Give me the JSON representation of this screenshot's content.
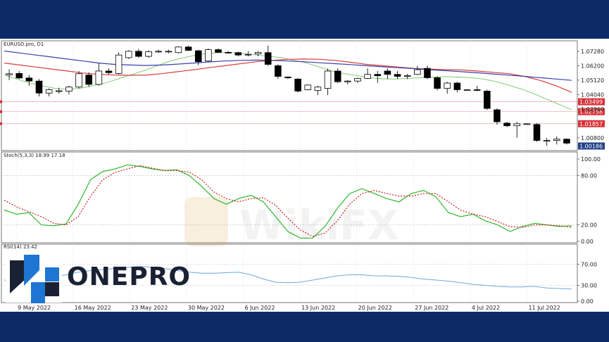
{
  "header": {
    "symbol_label": "EURUSD.pro, D1"
  },
  "stoch": {
    "label": "Stoch(5,3,3) 18.99 17.18"
  },
  "rsi": {
    "label": "RSI(14) 23.42"
  },
  "logo": {
    "text": "ONEPRO"
  },
  "watermark": {
    "text": "WikiFX"
  },
  "colors": {
    "frame": "#0b2a66",
    "ma_fast": "#79c46b",
    "ma_mid": "#d63d3d",
    "ma_slow": "#3b3ea8",
    "stoch_k": "#2eb82e",
    "stoch_d": "#cc2222",
    "rsi": "#6fa8dc",
    "price_box_red": "#d9333a",
    "price_box_blue": "#1f3f88",
    "logo_blue": "#1e76d2",
    "logo_dark": "#1a2133"
  },
  "chart_data": [
    {
      "type": "candlestick",
      "title": "EURUSD.pro, D1",
      "x_labels": [
        "9 May 2022",
        "16 May 2022",
        "23 May 2022",
        "30 May 2022",
        "6 Jun 2022",
        "13 Jun 2022",
        "20 Jun 2022",
        "27 Jun 2022",
        "4 Jul 2022",
        "11 Jul 2022"
      ],
      "y_ticks": [
        1.0728,
        1.062,
        1.0512,
        1.0404,
        1.0296,
        1.008
      ],
      "ylim": [
        1.0,
        1.078
      ],
      "price_markers": [
        {
          "value": 1.03499,
          "label": "1.03499",
          "style": "red"
        },
        {
          "value": 1.02758,
          "label": "1.02758",
          "style": "red"
        },
        {
          "value": 1.01857,
          "label": "1.01857",
          "style": "red"
        },
        {
          "value": 1.00186,
          "label": "1.00186",
          "style": "blue"
        }
      ],
      "candles": [
        {
          "o": 1.0552,
          "h": 1.0592,
          "l": 1.0512,
          "c": 1.056
        },
        {
          "o": 1.0562,
          "h": 1.058,
          "l": 1.052,
          "c": 1.0528
        },
        {
          "o": 1.0528,
          "h": 1.055,
          "l": 1.047,
          "c": 1.0505
        },
        {
          "o": 1.0505,
          "h": 1.052,
          "l": 1.039,
          "c": 1.0415
        },
        {
          "o": 1.0415,
          "h": 1.045,
          "l": 1.039,
          "c": 1.044
        },
        {
          "o": 1.043,
          "h": 1.0455,
          "l": 1.041,
          "c": 1.0432
        },
        {
          "o": 1.043,
          "h": 1.047,
          "l": 1.0405,
          "c": 1.046
        },
        {
          "o": 1.046,
          "h": 1.058,
          "l": 1.045,
          "c": 1.056
        },
        {
          "o": 1.055,
          "h": 1.057,
          "l": 1.046,
          "c": 1.048
        },
        {
          "o": 1.048,
          "h": 1.064,
          "l": 1.047,
          "c": 1.058
        },
        {
          "o": 1.058,
          "h": 1.06,
          "l": 1.0555,
          "c": 1.0568
        },
        {
          "o": 1.0562,
          "h": 1.072,
          "l": 1.0555,
          "c": 1.07
        },
        {
          "o": 1.068,
          "h": 1.0735,
          "l": 1.067,
          "c": 1.0728
        },
        {
          "o": 1.0728,
          "h": 1.0745,
          "l": 1.068,
          "c": 1.069
        },
        {
          "o": 1.069,
          "h": 1.0735,
          "l": 1.068,
          "c": 1.0725
        },
        {
          "o": 1.0725,
          "h": 1.074,
          "l": 1.0718,
          "c": 1.0728
        },
        {
          "o": 1.0728,
          "h": 1.074,
          "l": 1.0712,
          "c": 1.0728
        },
        {
          "o": 1.0718,
          "h": 1.0765,
          "l": 1.0712,
          "c": 1.076
        },
        {
          "o": 1.076,
          "h": 1.077,
          "l": 1.073,
          "c": 1.0735
        },
        {
          "o": 1.0732,
          "h": 1.074,
          "l": 1.0625,
          "c": 1.065
        },
        {
          "o": 1.0655,
          "h": 1.075,
          "l": 1.0648,
          "c": 1.074
        },
        {
          "o": 1.074,
          "h": 1.075,
          "l": 1.0715,
          "c": 1.072
        },
        {
          "o": 1.072,
          "h": 1.073,
          "l": 1.0712,
          "c": 1.0718
        },
        {
          "o": 1.0718,
          "h": 1.0725,
          "l": 1.069,
          "c": 1.07
        },
        {
          "o": 1.07,
          "h": 1.073,
          "l": 1.069,
          "c": 1.0705
        },
        {
          "o": 1.0708,
          "h": 1.073,
          "l": 1.069,
          "c": 1.072
        },
        {
          "o": 1.0718,
          "h": 1.077,
          "l": 1.062,
          "c": 1.063
        },
        {
          "o": 1.062,
          "h": 1.063,
          "l": 1.052,
          "c": 1.054
        },
        {
          "o": 1.0535,
          "h": 1.054,
          "l": 1.052,
          "c": 1.053
        },
        {
          "o": 1.052,
          "h": 1.0525,
          "l": 1.042,
          "c": 1.043
        },
        {
          "o": 1.044,
          "h": 1.048,
          "l": 1.0435,
          "c": 1.0475
        },
        {
          "o": 1.0435,
          "h": 1.047,
          "l": 1.04,
          "c": 1.046
        },
        {
          "o": 1.045,
          "h": 1.06,
          "l": 1.04,
          "c": 1.058
        },
        {
          "o": 1.058,
          "h": 1.06,
          "l": 1.049,
          "c": 1.05
        },
        {
          "o": 1.05,
          "h": 1.0512,
          "l": 1.048,
          "c": 1.0505
        },
        {
          "o": 1.0505,
          "h": 1.053,
          "l": 1.049,
          "c": 1.0525
        },
        {
          "o": 1.0525,
          "h": 1.06,
          "l": 1.052,
          "c": 1.0555
        },
        {
          "o": 1.0555,
          "h": 1.058,
          "l": 1.049,
          "c": 1.0545
        },
        {
          "o": 1.058,
          "h": 1.06,
          "l": 1.052,
          "c": 1.0555
        },
        {
          "o": 1.0555,
          "h": 1.058,
          "l": 1.052,
          "c": 1.054
        },
        {
          "o": 1.054,
          "h": 1.056,
          "l": 1.052,
          "c": 1.0545
        },
        {
          "o": 1.0555,
          "h": 1.062,
          "l": 1.055,
          "c": 1.059
        },
        {
          "o": 1.06,
          "h": 1.062,
          "l": 1.052,
          "c": 1.053
        },
        {
          "o": 1.053,
          "h": 1.054,
          "l": 1.0435,
          "c": 1.045
        },
        {
          "o": 1.045,
          "h": 1.05,
          "l": 1.041,
          "c": 1.049
        },
        {
          "o": 1.049,
          "h": 1.05,
          "l": 1.042,
          "c": 1.044
        },
        {
          "o": 1.044,
          "h": 1.0445,
          "l": 1.0435,
          "c": 1.044
        },
        {
          "o": 1.044,
          "h": 1.047,
          "l": 1.043,
          "c": 1.0435
        },
        {
          "o": 1.043,
          "h": 1.044,
          "l": 1.029,
          "c": 1.03
        },
        {
          "o": 1.029,
          "h": 1.03,
          "l": 1.018,
          "c": 1.02
        },
        {
          "o": 1.019,
          "h": 1.02,
          "l": 1.016,
          "c": 1.017
        },
        {
          "o": 1.017,
          "h": 1.02,
          "l": 1.008,
          "c": 1.0185
        },
        {
          "o": 1.0185,
          "h": 1.019,
          "l": 1.018,
          "c": 1.0185
        },
        {
          "o": 1.018,
          "h": 1.019,
          "l": 1.005,
          "c": 1.006
        },
        {
          "o": 1.0055,
          "h": 1.008,
          "l": 1.002,
          "c": 1.006
        },
        {
          "o": 1.006,
          "h": 1.009,
          "l": 1.003,
          "c": 1.007
        },
        {
          "o": 1.007,
          "h": 1.0075,
          "l": 1.003,
          "c": 1.004
        }
      ],
      "series": [
        {
          "key": "ma_fast",
          "color": "#79c46b",
          "values": [
            1.055,
            1.052,
            1.049,
            1.047,
            1.045,
            1.0445,
            1.045,
            1.047,
            1.049,
            1.052,
            1.055,
            1.058,
            1.0615,
            1.065,
            1.0675,
            1.0695,
            1.071,
            1.0718,
            1.0718,
            1.0712,
            1.07,
            1.069,
            1.068,
            1.066,
            1.064,
            1.061,
            1.058,
            1.056,
            1.0545,
            1.053,
            1.0522,
            1.052,
            1.0525,
            1.053,
            1.0535,
            1.0538,
            1.0535,
            1.053,
            1.052,
            1.05,
            1.0475,
            1.0445,
            1.041,
            1.037,
            1.033,
            1.029
          ]
        },
        {
          "key": "ma_mid",
          "color": "#d63d3d",
          "values": [
            1.064,
            1.0625,
            1.061,
            1.0595,
            1.058,
            1.0565,
            1.0555,
            1.055,
            1.0548,
            1.055,
            1.056,
            1.0575,
            1.059,
            1.0605,
            1.062,
            1.0635,
            1.065,
            1.066,
            1.0668,
            1.067,
            1.0668,
            1.066,
            1.0645,
            1.063,
            1.062,
            1.061,
            1.06,
            1.0595,
            1.059,
            1.0588,
            1.058,
            1.057,
            1.056,
            1.054,
            1.051,
            1.047,
            1.042
          ]
        },
        {
          "key": "ma_slow",
          "color": "#3b3ea8",
          "values": [
            1.073,
            1.0715,
            1.07,
            1.0685,
            1.067,
            1.0655,
            1.064,
            1.063,
            1.0625,
            1.0622,
            1.0625,
            1.0632,
            1.064,
            1.0648,
            1.0655,
            1.066,
            1.0662,
            1.066,
            1.0655,
            1.065,
            1.0642,
            1.0635,
            1.0628,
            1.062,
            1.0612,
            1.0605,
            1.0598,
            1.059,
            1.0583,
            1.0575,
            1.0567,
            1.0558,
            1.0549,
            1.054,
            1.053,
            1.052,
            1.051
          ]
        }
      ]
    },
    {
      "type": "line",
      "title": "Stoch(5,3,3) 18.99 17.18",
      "y_ticks": [
        100.0,
        80.0,
        20.0,
        0.0
      ],
      "ylim": [
        0,
        100
      ],
      "series": [
        {
          "key": "k",
          "color": "#2eb82e",
          "values": [
            38,
            33,
            35,
            20,
            19,
            21,
            45,
            75,
            85,
            88,
            93,
            91,
            88,
            86,
            87,
            80,
            67,
            52,
            45,
            52,
            56,
            48,
            30,
            12,
            4,
            4,
            18,
            40,
            58,
            64,
            58,
            52,
            48,
            58,
            62,
            54,
            35,
            30,
            33,
            25,
            20,
            12,
            18,
            22,
            20,
            18,
            19
          ]
        },
        {
          "key": "d",
          "color": "#cc2222",
          "values": [
            50,
            42,
            36,
            30,
            22,
            20,
            30,
            55,
            75,
            84,
            88,
            92,
            89,
            86,
            86,
            84,
            75,
            60,
            52,
            48,
            52,
            53,
            44,
            28,
            14,
            6,
            10,
            25,
            45,
            58,
            62,
            58,
            55,
            55,
            58,
            58,
            48,
            38,
            33,
            30,
            24,
            18,
            17,
            20,
            20,
            19,
            17
          ]
        }
      ]
    },
    {
      "type": "line",
      "title": "RSI(14) 23.42",
      "y_ticks": [
        70.0,
        30.0,
        0.0
      ],
      "ylim": [
        0,
        100
      ],
      "series": [
        {
          "key": "rsi",
          "color": "#6fa8dc",
          "values": [
            40,
            38,
            40,
            42,
            45,
            50,
            55,
            58,
            60,
            62,
            64,
            66,
            64,
            62,
            58,
            55,
            53,
            53,
            54,
            55,
            50,
            42,
            36,
            35,
            36,
            40,
            44,
            48,
            50,
            50,
            48,
            48,
            47,
            45,
            42,
            40,
            38,
            35,
            32,
            30,
            28,
            27,
            27,
            28,
            25,
            24,
            23
          ]
        }
      ]
    }
  ]
}
